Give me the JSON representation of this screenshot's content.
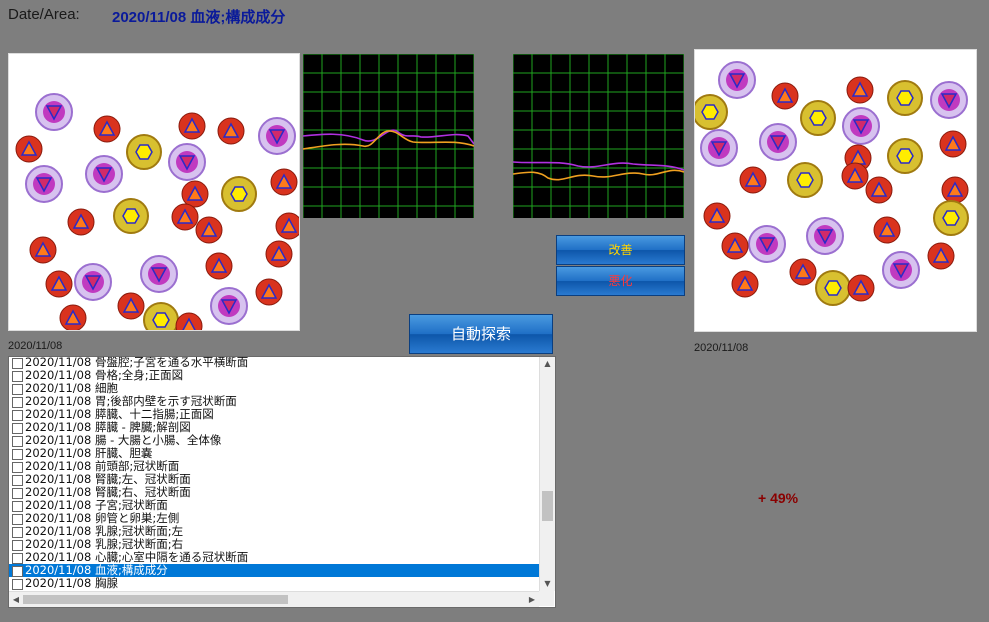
{
  "header": {
    "label": "Date/Area:",
    "value": "2020/11/08  血液;構成成分"
  },
  "buttons": {
    "improve": "改善",
    "worsen": "悪化",
    "auto_search": "自動探索"
  },
  "left_panel": {
    "date": "2020/11/08"
  },
  "right_panel": {
    "date": "2020/11/08"
  },
  "result": {
    "percent": "+ 49%"
  },
  "colors": {
    "accent": "#0078d7",
    "graph_grid": "#1fa51f",
    "purple_line": "#b030e0",
    "orange_line": "#f0a020",
    "percent": "#8a0000"
  },
  "list": {
    "items": [
      "2020/11/08  骨盤腔;子宮を通る水平横断面",
      "2020/11/08  骨格;全身;正面図",
      "2020/11/08  細胞",
      "2020/11/08  胃;後部内壁を示す冠状断面",
      "2020/11/08  膵臓、十二指腸;正面図",
      "2020/11/08  膵臓 - 脾臓;解剖図",
      "2020/11/08  腸 - 大腸と小腸、全体像",
      "2020/11/08  肝臓、胆嚢",
      "2020/11/08  前頭部;冠状断面",
      "2020/11/08  腎臓;左、冠状断面",
      "2020/11/08  腎臓;右、冠状断面",
      "2020/11/08  子宮;冠状断面",
      "2020/11/08  卵管と卵巣;左側",
      "2020/11/08  乳腺;冠状断面;左",
      "2020/11/08  乳腺;冠状断面;右",
      "2020/11/08  心臓;心室中隔を通る冠状断面",
      "2020/11/08  血液;構成成分",
      "2020/11/08  胸腺"
    ],
    "selected_index": 16
  }
}
